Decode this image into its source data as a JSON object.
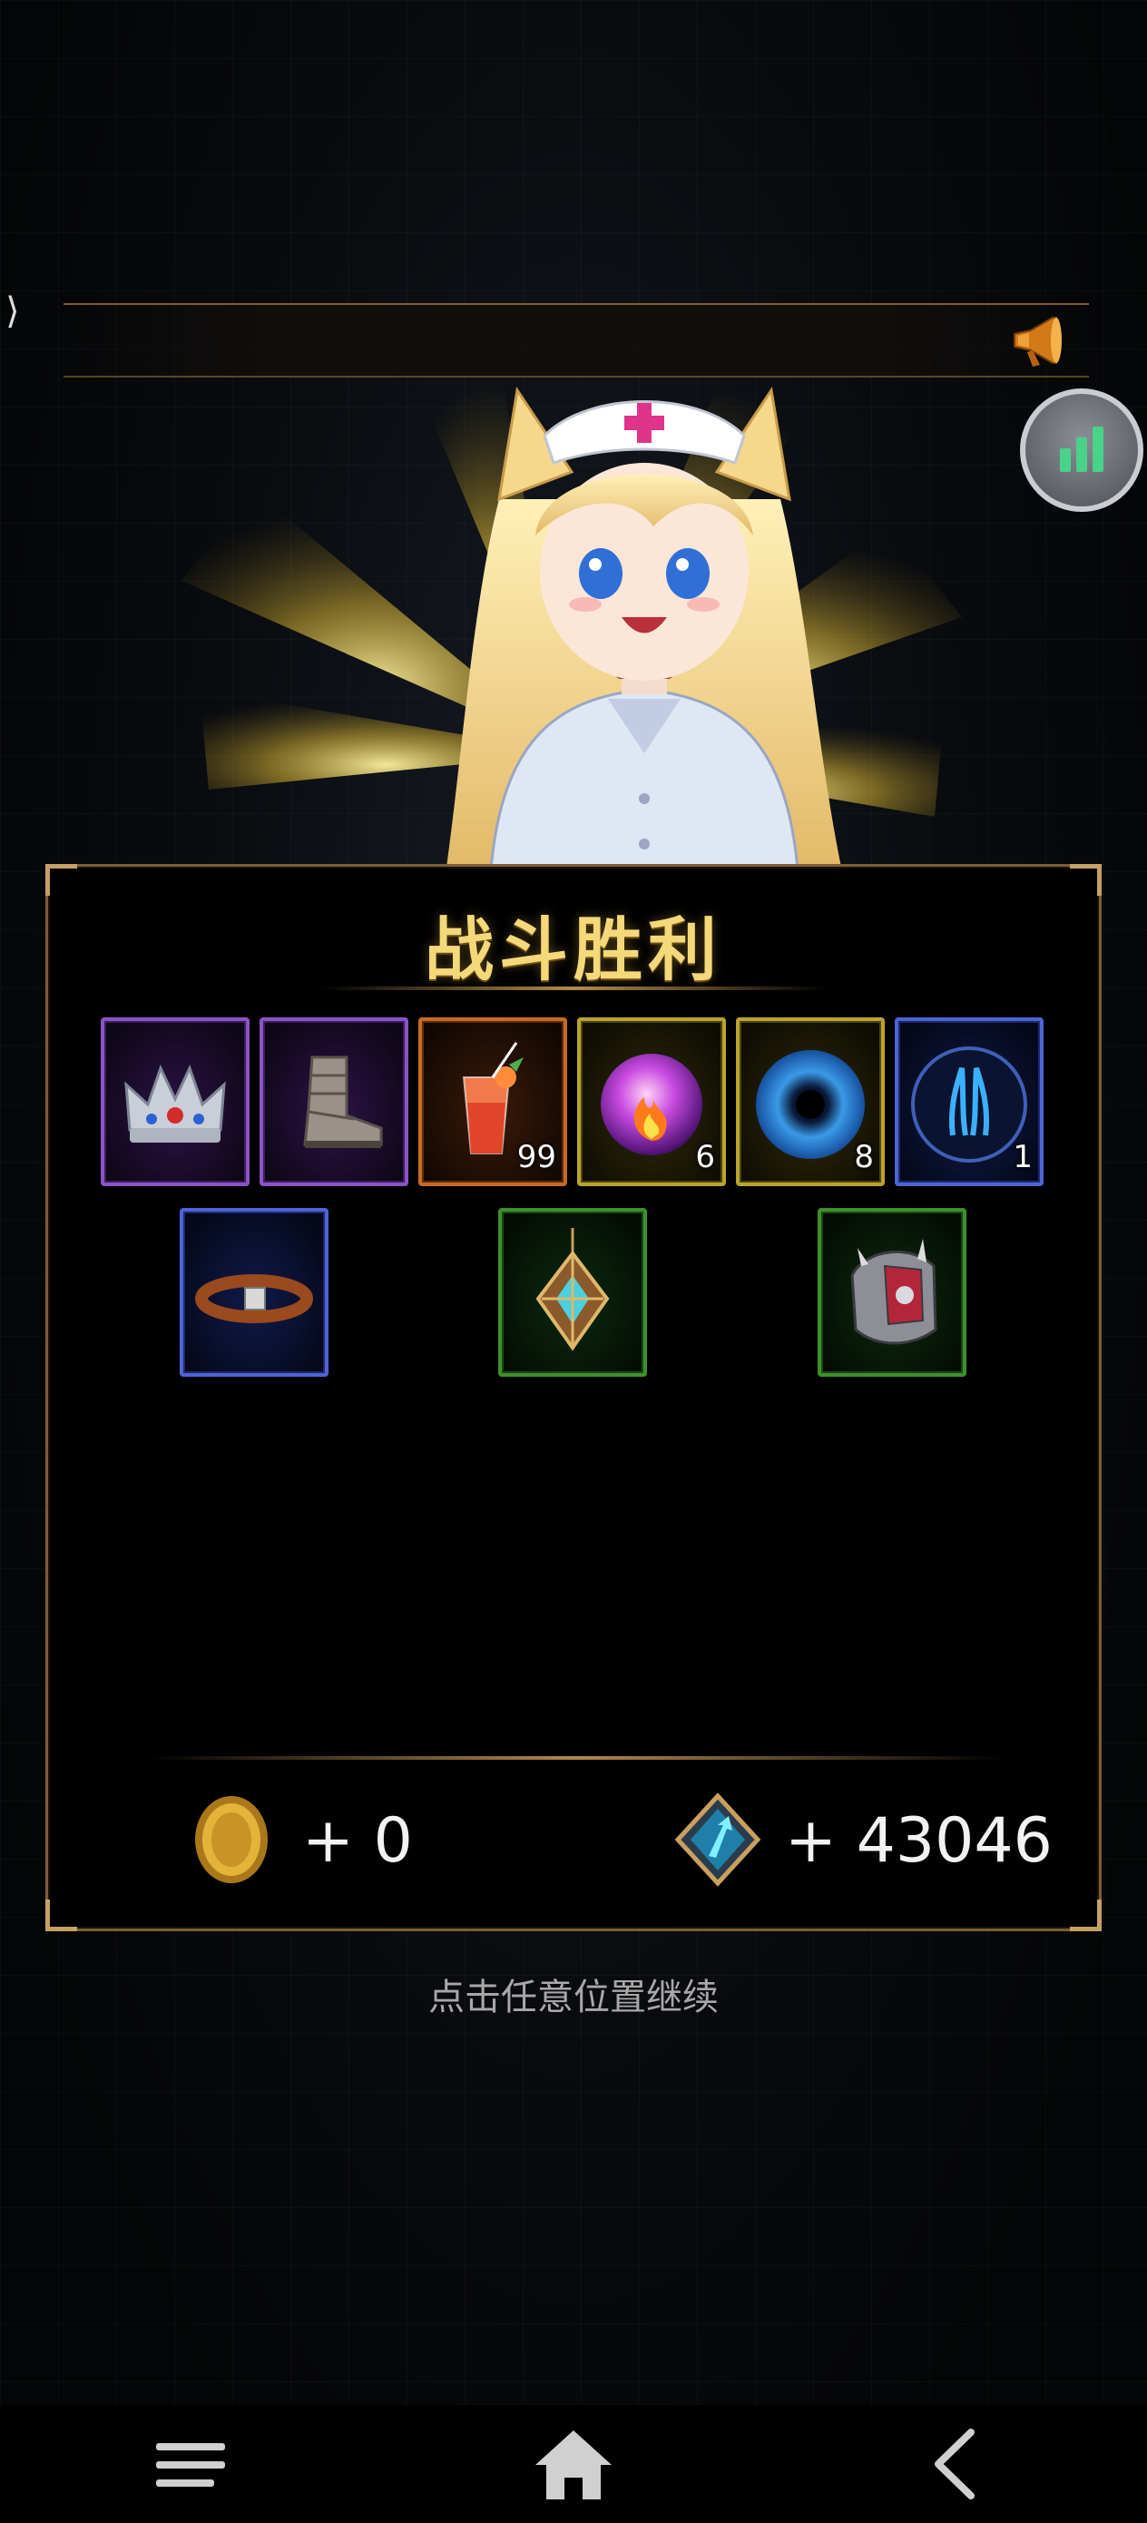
{
  "side_tab": {
    "glyph": "⟩"
  },
  "victory_panel": {
    "title": "战斗胜利",
    "items_row1": [
      {
        "name": "crown",
        "rarity": "purple",
        "quantity": ""
      },
      {
        "name": "boots",
        "rarity": "purple",
        "quantity": ""
      },
      {
        "name": "cocktail",
        "rarity": "orange",
        "quantity": "99"
      },
      {
        "name": "fire-orb",
        "rarity": "gold",
        "quantity": "6"
      },
      {
        "name": "void-orb",
        "rarity": "gold",
        "quantity": "8"
      },
      {
        "name": "blue-rune",
        "rarity": "blue",
        "quantity": "1"
      }
    ],
    "items_row2": [
      {
        "name": "leather-belt",
        "rarity": "blue",
        "quantity": ""
      },
      {
        "name": "amulet",
        "rarity": "green",
        "quantity": ""
      },
      {
        "name": "shoulder-armor",
        "rarity": "green",
        "quantity": ""
      }
    ],
    "rewards": {
      "gold": "+ 0",
      "crystal": "+ 43046"
    }
  },
  "continue_hint": "点击任意位置继续",
  "rarity_colors": {
    "purple": "#8b53c6",
    "orange": "#c86a22",
    "gold": "#b9a42e",
    "blue": "#4d63d6",
    "green": "#3e8f2c"
  },
  "icons": {
    "announcement": "horn-icon",
    "stats": "bar-chart-icon",
    "nav": [
      "menu-icon",
      "home-icon",
      "back-icon"
    ]
  }
}
